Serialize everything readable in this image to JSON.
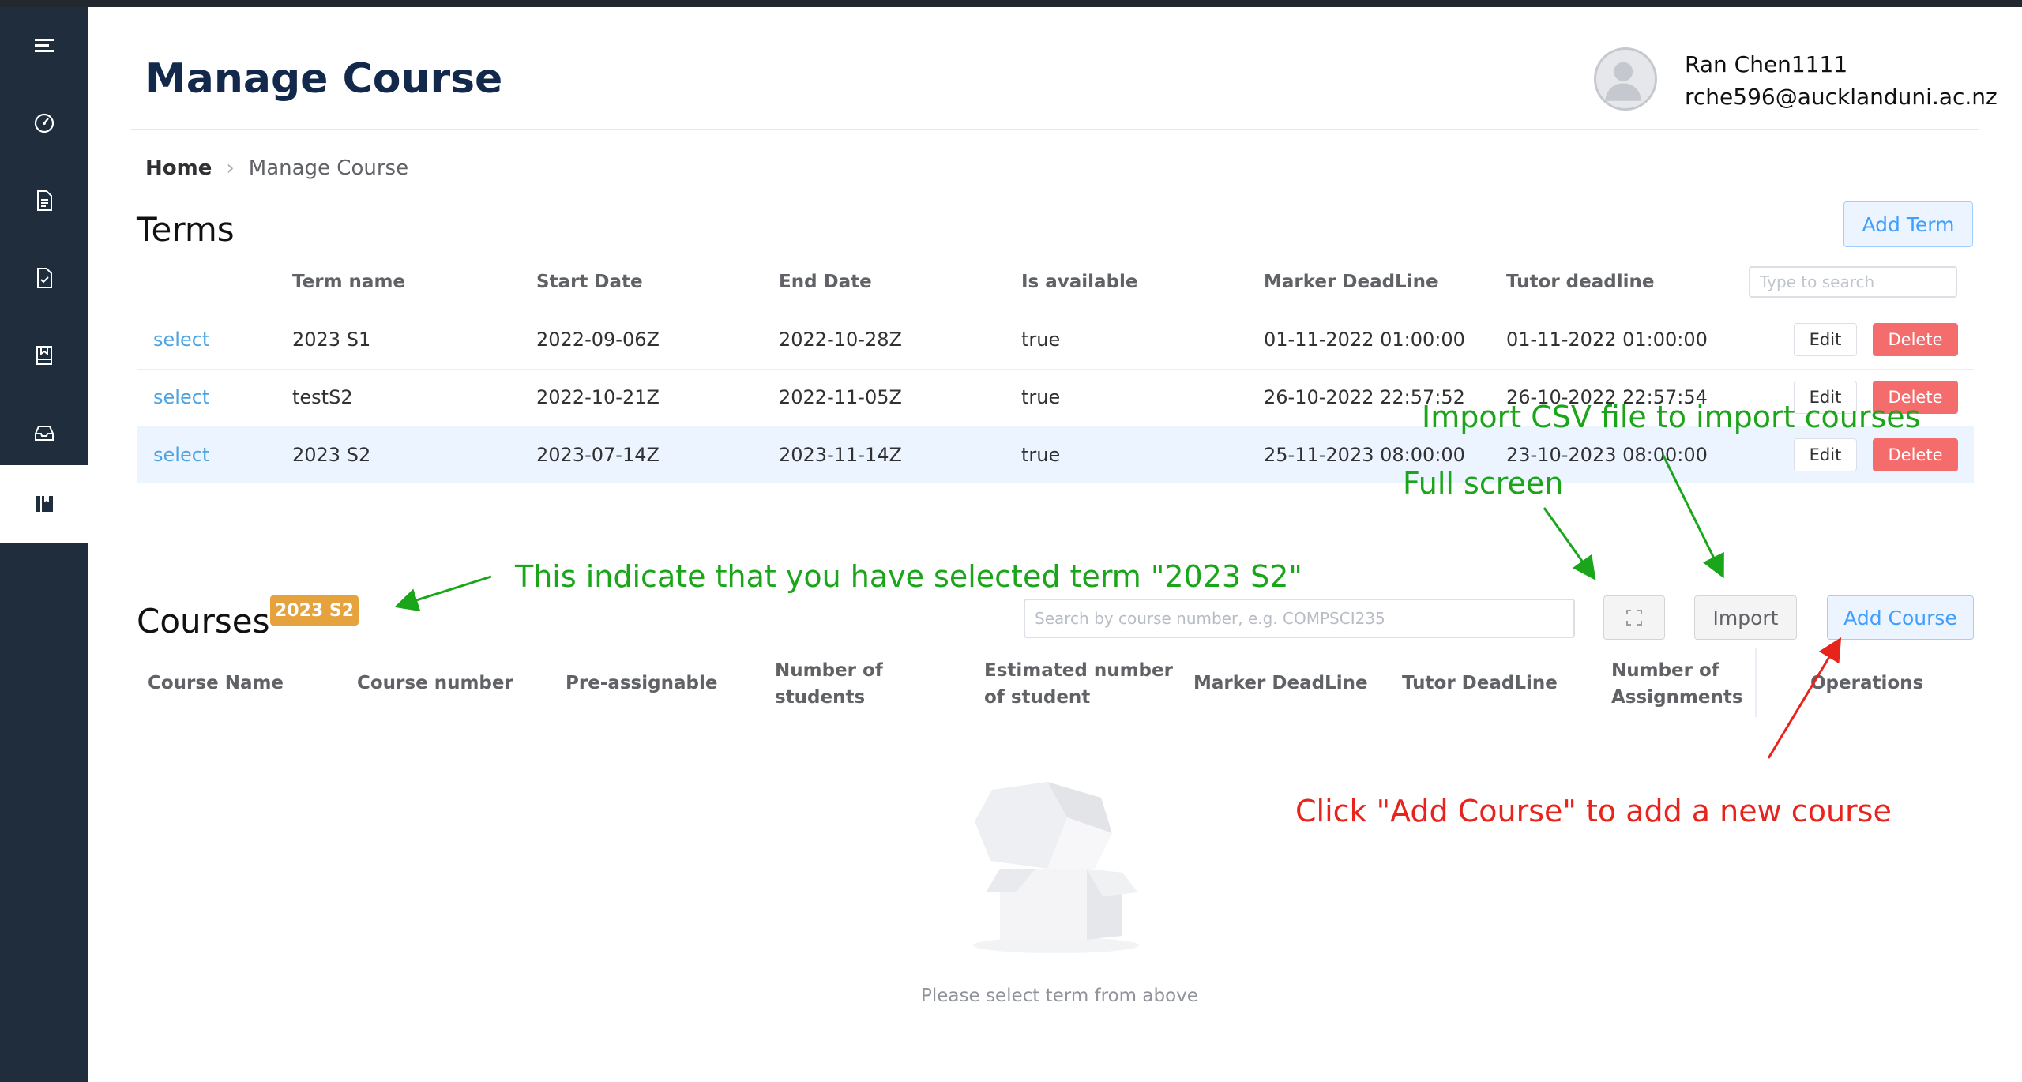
{
  "header": {
    "title": "Manage Course",
    "user_name": "Ran Chen1111",
    "user_email": "rche596@aucklanduni.ac.nz"
  },
  "breadcrumb": {
    "home": "Home",
    "current": "Manage Course"
  },
  "sidebar": {
    "items": [
      {
        "icon": "menu-icon"
      },
      {
        "icon": "dashboard-icon"
      },
      {
        "icon": "document-icon"
      },
      {
        "icon": "checklist-icon"
      },
      {
        "icon": "bookmark-icon"
      },
      {
        "icon": "inbox-icon"
      },
      {
        "icon": "course-icon",
        "active": true
      }
    ]
  },
  "terms": {
    "title": "Terms",
    "add_label": "Add Term",
    "search_placeholder": "Type to search",
    "columns": [
      "Term name",
      "Start Date",
      "End Date",
      "Is available",
      "Marker DeadLine",
      "Tutor deadline"
    ],
    "rows": [
      {
        "select": "select",
        "name": "2023 S1",
        "start": "2022-09-06Z",
        "end": "2022-10-28Z",
        "available": "true",
        "marker": "01-11-2022 01:00:00",
        "tutor": "01-11-2022 01:00:00",
        "edit": "Edit",
        "delete": "Delete"
      },
      {
        "select": "select",
        "name": "testS2",
        "start": "2022-10-21Z",
        "end": "2022-11-05Z",
        "available": "true",
        "marker": "26-10-2022 22:57:52",
        "tutor": "26-10-2022 22:57:54",
        "edit": "Edit",
        "delete": "Delete"
      },
      {
        "select": "select",
        "name": "2023 S2",
        "start": "2023-07-14Z",
        "end": "2023-11-14Z",
        "available": "true",
        "marker": "25-11-2023 08:00:00",
        "tutor": "23-10-2023 08:00:00",
        "edit": "Edit",
        "delete": "Delete"
      }
    ]
  },
  "courses": {
    "title": "Courses",
    "selected_term": "2023 S2",
    "search_placeholder": "Search by course number, e.g. COMPSCI235",
    "import_label": "Import",
    "add_label": "Add Course",
    "columns": [
      "Course Name",
      "Course number",
      "Pre-assignable",
      "Number of students",
      "Estimated number of student",
      "Marker DeadLine",
      "Tutor DeadLine",
      "Number of Assignments",
      "Operations"
    ],
    "empty_text": "Please select term from above"
  },
  "annotations": {
    "import_csv": "Import CSV file to import courses",
    "full_screen": "Full screen",
    "selected_term": "This indicate that you have selected term \"2023 S2\"",
    "add_course": "Click \"Add Course\" to add a new course"
  },
  "colors": {
    "sidebar": "#1f2d3d",
    "primary": "#409eff",
    "danger": "#f56c6c",
    "warning": "#e6a23c",
    "annotation_green": "#1aa51a",
    "annotation_red": "#e8231c"
  }
}
